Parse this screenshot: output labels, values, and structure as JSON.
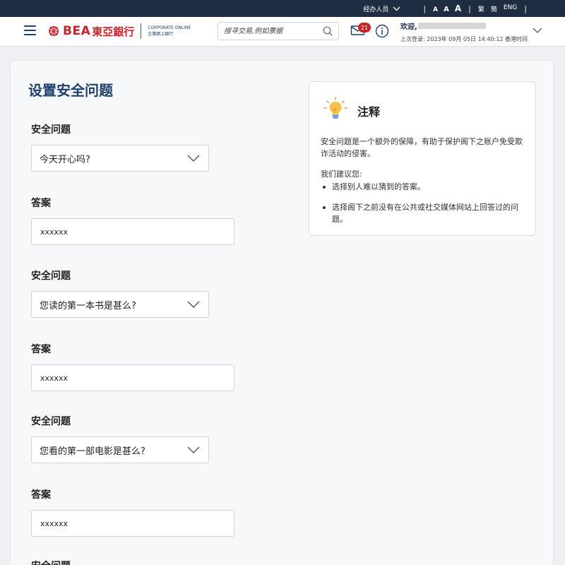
{
  "topbar": {
    "role": "经办人员",
    "font_sizes": [
      "A",
      "A",
      "A"
    ],
    "lang_trad": "繁",
    "lang_simp": "簡",
    "lang_eng": "ENG"
  },
  "header": {
    "logo_bea": "BEA",
    "logo_cn": "東亞銀行",
    "logo_sub1": "CORPORATE ONLINE",
    "logo_sub2": "企業網上銀行",
    "search_placeholder": "搜寻交易,例如票据",
    "mail_count": "21",
    "welcome": "欢迎,",
    "last_login": "上次登录: 2023年 09月 05日 14:40:12 香港时间"
  },
  "page": {
    "title": "设置安全问题",
    "question_label": "安全问题",
    "answer_label": "答案",
    "pairs": [
      {
        "question": "今天开心吗?",
        "answer": "xxxxxx"
      },
      {
        "question": "您读的第一本书是甚么?",
        "answer": "xxxxxx"
      },
      {
        "question": "您看的第一部电影是甚么?",
        "answer": "xxxxxx"
      }
    ]
  },
  "note": {
    "title": "注释",
    "paragraph": "安全问题是一个额外的保障，有助于保护阁下之账户免受欺诈活动的侵害。",
    "recommend": "我们建议您:",
    "tips": [
      "选择别人难以猜到的答案。",
      "选择阁下之前没有在公共或社交媒体网站上回答过的问题。"
    ]
  },
  "colors": {
    "topbar": "#1f2d42",
    "brand_red": "#c8222a",
    "title_blue": "#1f3f6e"
  }
}
